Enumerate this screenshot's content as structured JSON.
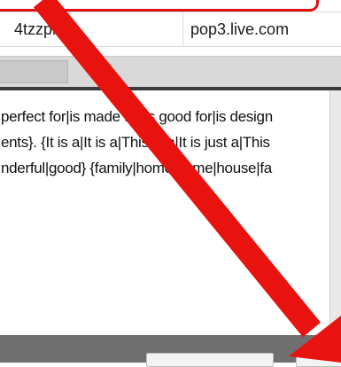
{
  "account_table": {
    "row": {
      "password": "4tzzpi5y",
      "server": "pop3.live.com"
    }
  },
  "text_editor": {
    "lines": [
      "perfect for|is made for|is good for|is design",
      "ents}. {It is a|It is a|This is a|It is just a|This",
      "nderful|good} {family|home|home|house|fa"
    ]
  },
  "colors": {
    "annotation_arrow": "#e8130f",
    "scrollbar": "#d9d9d9",
    "bottom_bar": "#6f6f6f"
  },
  "icons": {
    "annotation": "red-arrow-annotation"
  }
}
